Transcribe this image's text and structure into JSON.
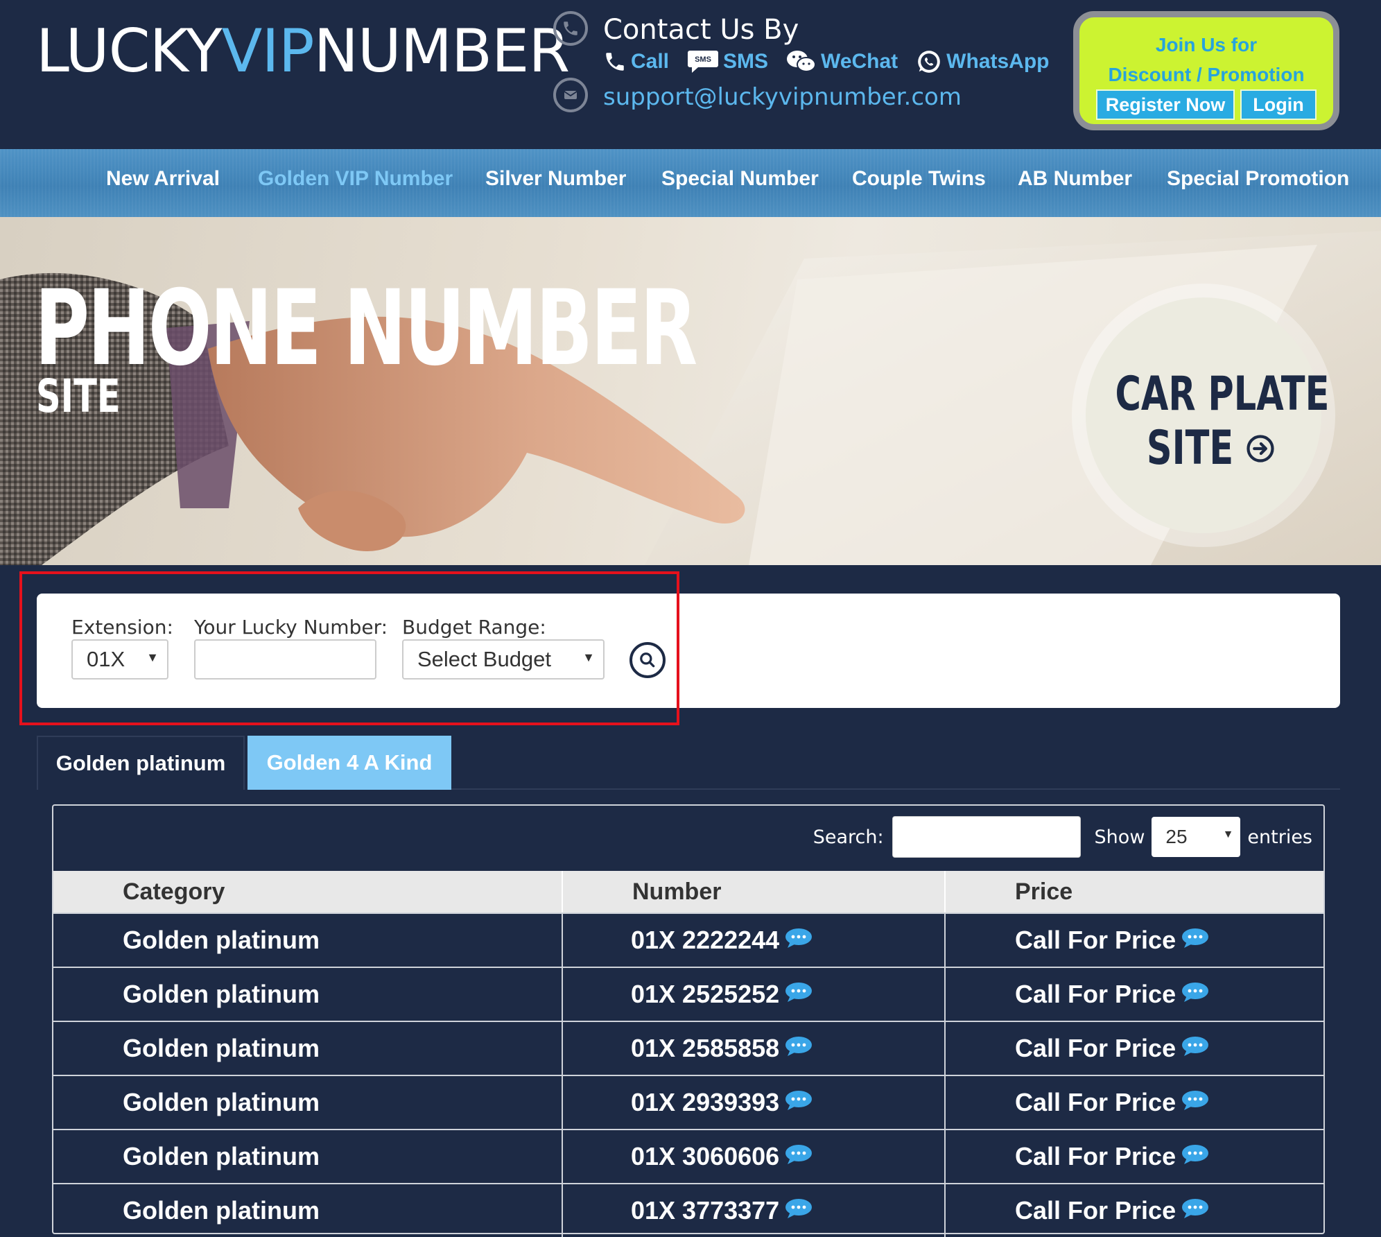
{
  "header": {
    "logo_part1": "LUCKY",
    "logo_part2": "VIP",
    "logo_part3": "NUMBER",
    "contact_title": "Contact Us By",
    "call": "Call",
    "sms": "SMS",
    "sms_icon_text": "SMS",
    "wechat": "WeChat",
    "whatsapp": "WhatsApp",
    "email": "support@luckyvipnumber.com",
    "join_line1": "Join Us for",
    "join_line2": "Discount / Promotion",
    "register": "Register Now",
    "login": "Login"
  },
  "nav": [
    {
      "label": "New Arrival",
      "active": false
    },
    {
      "label": "Golden VIP Number",
      "active": true
    },
    {
      "label": "Silver Number",
      "active": false
    },
    {
      "label": "Special Number",
      "active": false
    },
    {
      "label": "Couple Twins",
      "active": false
    },
    {
      "label": "AB Number",
      "active": false
    },
    {
      "label": "Special Promotion",
      "active": false
    }
  ],
  "hero": {
    "title": "PHONE NUMBER",
    "subtitle": "SITE",
    "car_plate_line1": "CAR PLATE",
    "car_plate_line2": "SITE"
  },
  "search": {
    "extension_label": "Extension:",
    "extension_value": "01X",
    "lucky_label": "Your Lucky Number:",
    "lucky_value": "",
    "budget_label": "Budget Range:",
    "budget_value": "Select Budget"
  },
  "tabs": [
    {
      "label": "Golden platinum",
      "active": true
    },
    {
      "label": "Golden 4 A Kind",
      "active": false
    }
  ],
  "table": {
    "search_label": "Search:",
    "show_label": "Show",
    "show_value": "25",
    "entries_label": "entries",
    "headers": [
      "Category",
      "Number",
      "Price"
    ],
    "rows": [
      {
        "category": "Golden platinum",
        "number": "01X 2222244",
        "price": "Call For Price"
      },
      {
        "category": "Golden platinum",
        "number": "01X 2525252",
        "price": "Call For Price"
      },
      {
        "category": "Golden platinum",
        "number": "01X 2585858",
        "price": "Call For Price"
      },
      {
        "category": "Golden platinum",
        "number": "01X 2939393",
        "price": "Call For Price"
      },
      {
        "category": "Golden platinum",
        "number": "01X 3060606",
        "price": "Call For Price"
      },
      {
        "category": "Golden platinum",
        "number": "01X 3773377",
        "price": "Call For Price"
      }
    ]
  },
  "colors": {
    "background": "#1d2a45",
    "accent": "#5cb8ee",
    "join_box": "#ccf331",
    "highlight": "#e5111c"
  }
}
